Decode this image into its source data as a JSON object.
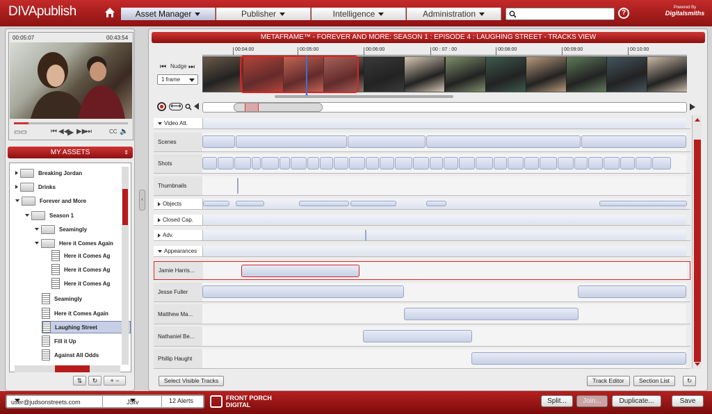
{
  "app": {
    "logo": "DIVApublish",
    "powered_line1": "Powered By",
    "powered_line2": "Digitalsmiths"
  },
  "nav": {
    "menus": [
      "Asset Manager",
      "Publisher",
      "Intelligence",
      "Administration"
    ],
    "active": "Asset Manager",
    "search_placeholder": "",
    "help": "?"
  },
  "player": {
    "current_time": "00:05:07",
    "duration": "00:43:54",
    "progress": 0.13
  },
  "assets": {
    "title": "MY ASSETS",
    "tree": [
      {
        "label": "Breaking Jordan",
        "type": "folder",
        "depth": 0,
        "expander": "closed"
      },
      {
        "label": "Drinks",
        "type": "folder",
        "depth": 0,
        "expander": "closed"
      },
      {
        "label": "Forever and More",
        "type": "folder",
        "depth": 0,
        "expander": "open"
      },
      {
        "label": "Season 1",
        "type": "folder",
        "depth": 1,
        "expander": "open"
      },
      {
        "label": "Seamingly",
        "type": "folder",
        "depth": 2,
        "expander": "open"
      },
      {
        "label": "Here it Comes Again",
        "type": "folder",
        "depth": 2,
        "expander": "open"
      },
      {
        "label": "Here it Comes Ag",
        "type": "file",
        "depth": 3
      },
      {
        "label": "Here it Comes Ag",
        "type": "file",
        "depth": 3
      },
      {
        "label": "Here it Comes Ag",
        "type": "file",
        "depth": 3
      },
      {
        "label": "Seamingly",
        "type": "file",
        "depth": 2
      },
      {
        "label": "Here it Comes Again",
        "type": "file",
        "depth": 2
      },
      {
        "label": "Laughing Street",
        "type": "file",
        "depth": 2,
        "selected": true
      },
      {
        "label": "Fill it Up",
        "type": "file",
        "depth": 2
      },
      {
        "label": "Against All Odds",
        "type": "file",
        "depth": 2
      }
    ]
  },
  "main": {
    "title": "METAFRAME™ - FOREVER AND MORE: SEASON 1 : EPISODE 4 : LAUGHING STREET - TRACKS VIEW",
    "nudge": "Nudge",
    "frame_step": "1 frame",
    "ruler_ticks": [
      "00:04:00",
      "00:05:00",
      "00:06:00",
      "00 : 07 : 00",
      "00:08:00",
      "00:09:00",
      "00:10:00"
    ],
    "tracks": [
      {
        "label": "Video Att.",
        "kind": "section",
        "expander": "open"
      },
      {
        "label": "Scenes",
        "kind": "track"
      },
      {
        "label": "Shots",
        "kind": "track"
      },
      {
        "label": "Thumbnails",
        "kind": "track"
      },
      {
        "label": "Objects",
        "kind": "section",
        "expander": "closed"
      },
      {
        "label": "Closed Cap.",
        "kind": "section",
        "expander": "closed"
      },
      {
        "label": "Adv.",
        "kind": "section",
        "expander": "closed"
      },
      {
        "label": "Appearances",
        "kind": "section",
        "expander": "open"
      },
      {
        "label": "Jamie Harris...",
        "kind": "track",
        "highlight": true
      },
      {
        "label": "Jesse Fuller",
        "kind": "track"
      },
      {
        "label": "Matthew Ma...",
        "kind": "track"
      },
      {
        "label": "Nathaniel Be...",
        "kind": "track"
      },
      {
        "label": "Phillip Haught",
        "kind": "track"
      }
    ],
    "buttons": {
      "select_visible": "Select Visible Tracks",
      "track_editor": "Track Editor",
      "section_list": "Section List"
    }
  },
  "footer": {
    "user": "user@judsonstreets.com",
    "channel": "JStv",
    "alerts": "12 Alerts",
    "brand": "FRONT PORCH DIGITAL",
    "split": "Split...",
    "join": "Join...",
    "duplicate": "Duplicate...",
    "save": "Save"
  },
  "colors": {
    "brand_red": "#b61c1c",
    "selection_blue": "#c7cfe6",
    "segment_blue": "#c8d1e6"
  }
}
